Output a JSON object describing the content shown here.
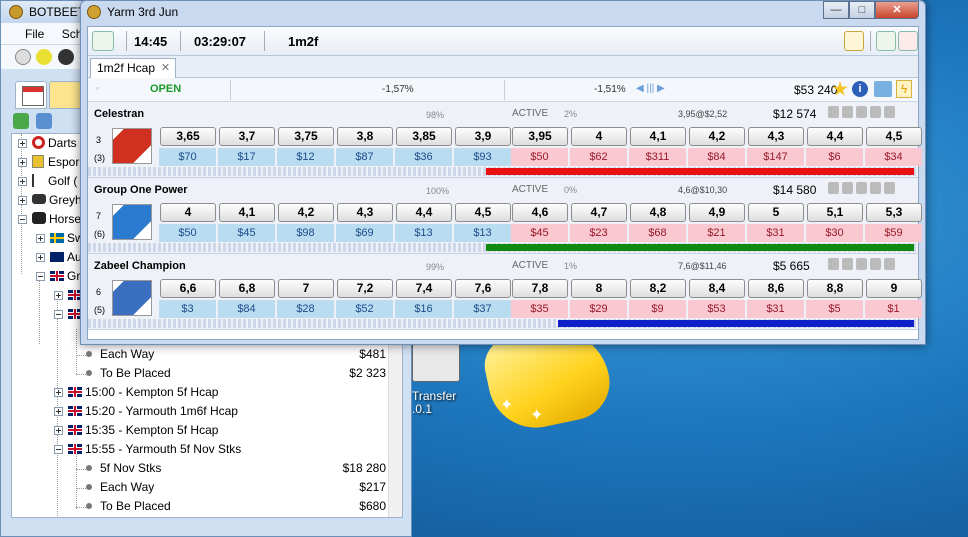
{
  "back_window": {
    "title": "BOTBEET",
    "menu": [
      "File",
      "Sch"
    ],
    "tree": [
      {
        "label": "Darts",
        "level": 1
      },
      {
        "label": "Espor",
        "level": 1
      },
      {
        "label": "Golf (",
        "level": 1
      },
      {
        "label": "Greyh",
        "level": 1
      },
      {
        "label": "Horse",
        "level": 1
      },
      {
        "label": "Sw",
        "level": 2
      },
      {
        "label": "Au",
        "level": 2
      },
      {
        "label": "Gr",
        "level": 2
      },
      {
        "label": "Each Way",
        "amount": "$481",
        "level": 4
      },
      {
        "label": "To Be Placed",
        "amount": "$2 323",
        "level": 4
      },
      {
        "label": "15:00 - Kempton 5f Hcap",
        "level": 3
      },
      {
        "label": "15:20 - Yarmouth 1m6f Hcap",
        "level": 3
      },
      {
        "label": "15:35 - Kempton 5f Hcap",
        "level": 3
      },
      {
        "label": "15:55 - Yarmouth 5f Nov Stks",
        "level": 3
      },
      {
        "label": "5f Nov Stks",
        "amount": "$18 280",
        "level": 4
      },
      {
        "label": "Each Way",
        "amount": "$217",
        "level": 4
      },
      {
        "label": "To Be Placed",
        "amount": "$680",
        "level": 4
      }
    ]
  },
  "front_window": {
    "title": "Yarm  3rd Jun",
    "toolbar": {
      "time": "14:45",
      "countdown": "03:29:07",
      "distance": "1m2f"
    },
    "tab": "1m2f Hcap",
    "status": {
      "open": "OPEN",
      "back_pct": "-1,57%",
      "lay_pct": "-1,51%",
      "matched": "$53 240"
    },
    "runners": [
      {
        "name": "Celestran",
        "pct": "98%",
        "state": "ACTIVE",
        "state_pct": "2%",
        "pnl": "3,95@$2,52",
        "matched": "$12 574",
        "number": "3",
        "draw": "(3)",
        "bar_color": "#e81010",
        "back_prices": [
          "3,65",
          "3,7",
          "3,75",
          "3,8",
          "3,85",
          "3,9"
        ],
        "back_stakes": [
          "$70",
          "$17",
          "$12",
          "$87",
          "$36",
          "$93"
        ],
        "lay_prices": [
          "3,95",
          "4",
          "4,1",
          "4,2",
          "4,3",
          "4,4",
          "4,5"
        ],
        "lay_stakes": [
          "$50",
          "$62",
          "$311",
          "$84",
          "$147",
          "$6",
          "$34"
        ]
      },
      {
        "name": "Group One Power",
        "pct": "100%",
        "state": "ACTIVE",
        "state_pct": "0%",
        "pnl": "4,6@$10,30",
        "matched": "$14 580",
        "number": "7",
        "draw": "(6)",
        "bar_color": "#108a10",
        "back_prices": [
          "4",
          "4,1",
          "4,2",
          "4,3",
          "4,4",
          "4,5"
        ],
        "back_stakes": [
          "$50",
          "$45",
          "$98",
          "$69",
          "$13",
          "$13"
        ],
        "lay_prices": [
          "4,6",
          "4,7",
          "4,8",
          "4,9",
          "5",
          "5,1",
          "5,3"
        ],
        "lay_stakes": [
          "$45",
          "$23",
          "$68",
          "$21",
          "$31",
          "$30",
          "$59"
        ]
      },
      {
        "name": "Zabeel Champion",
        "pct": "99%",
        "state": "ACTIVE",
        "state_pct": "1%",
        "pnl": "7,6@$11,46",
        "matched": "$5 665",
        "number": "6",
        "draw": "(5)",
        "bar_color": "#1020c8",
        "back_prices": [
          "6,6",
          "6,8",
          "7",
          "7,2",
          "7,4",
          "7,6"
        ],
        "back_stakes": [
          "$3",
          "$84",
          "$28",
          "$52",
          "$16",
          "$37"
        ],
        "lay_prices": [
          "7,8",
          "8",
          "8,2",
          "8,4",
          "8,6",
          "8,8",
          "9"
        ],
        "lay_stakes": [
          "$35",
          "$29",
          "$9",
          "$53",
          "$31",
          "$5",
          "$1"
        ]
      }
    ]
  },
  "desktop": {
    "icon_label_1": "Transfer",
    "icon_label_2": ".0.1"
  }
}
